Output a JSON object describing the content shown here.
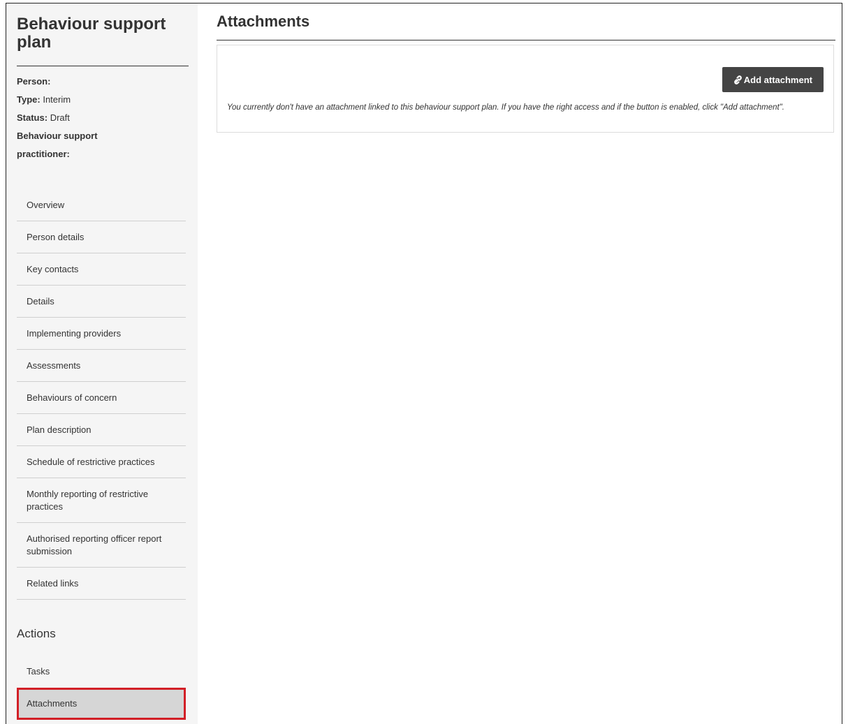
{
  "sidebar": {
    "title": "Behaviour support plan",
    "meta": {
      "person_label": "Person:",
      "person_value": "",
      "type_label": "Type:",
      "type_value": "Interim",
      "status_label": "Status:",
      "status_value": "Draft",
      "practitioner_label_line1": "Behaviour support",
      "practitioner_label_line2": "practitioner:",
      "practitioner_value": ""
    },
    "nav_items": [
      {
        "label": "Overview"
      },
      {
        "label": "Person details"
      },
      {
        "label": "Key contacts"
      },
      {
        "label": "Details"
      },
      {
        "label": "Implementing providers"
      },
      {
        "label": "Assessments"
      },
      {
        "label": "Behaviours of concern"
      },
      {
        "label": "Plan description"
      },
      {
        "label": "Schedule of restrictive practices"
      },
      {
        "label": "Monthly reporting of restrictive practices"
      },
      {
        "label": "Authorised reporting officer report submission"
      },
      {
        "label": "Related links"
      }
    ],
    "actions_heading": "Actions",
    "action_items": [
      {
        "label": "Tasks"
      },
      {
        "label": "Attachments",
        "active": true
      }
    ]
  },
  "main": {
    "title": "Attachments",
    "add_button_label": "Add attachment",
    "add_button_icon": "paperclip-icon",
    "empty_message": "You currently don't have an attachment linked to this behaviour support plan. If you have the right access and if the button is enabled, click \"Add attachment\"."
  },
  "colors": {
    "sidebar_bg": "#f5f5f5",
    "button_bg": "#444444",
    "active_item_bg": "#d6d6d6",
    "highlight_border": "#d21f26"
  }
}
